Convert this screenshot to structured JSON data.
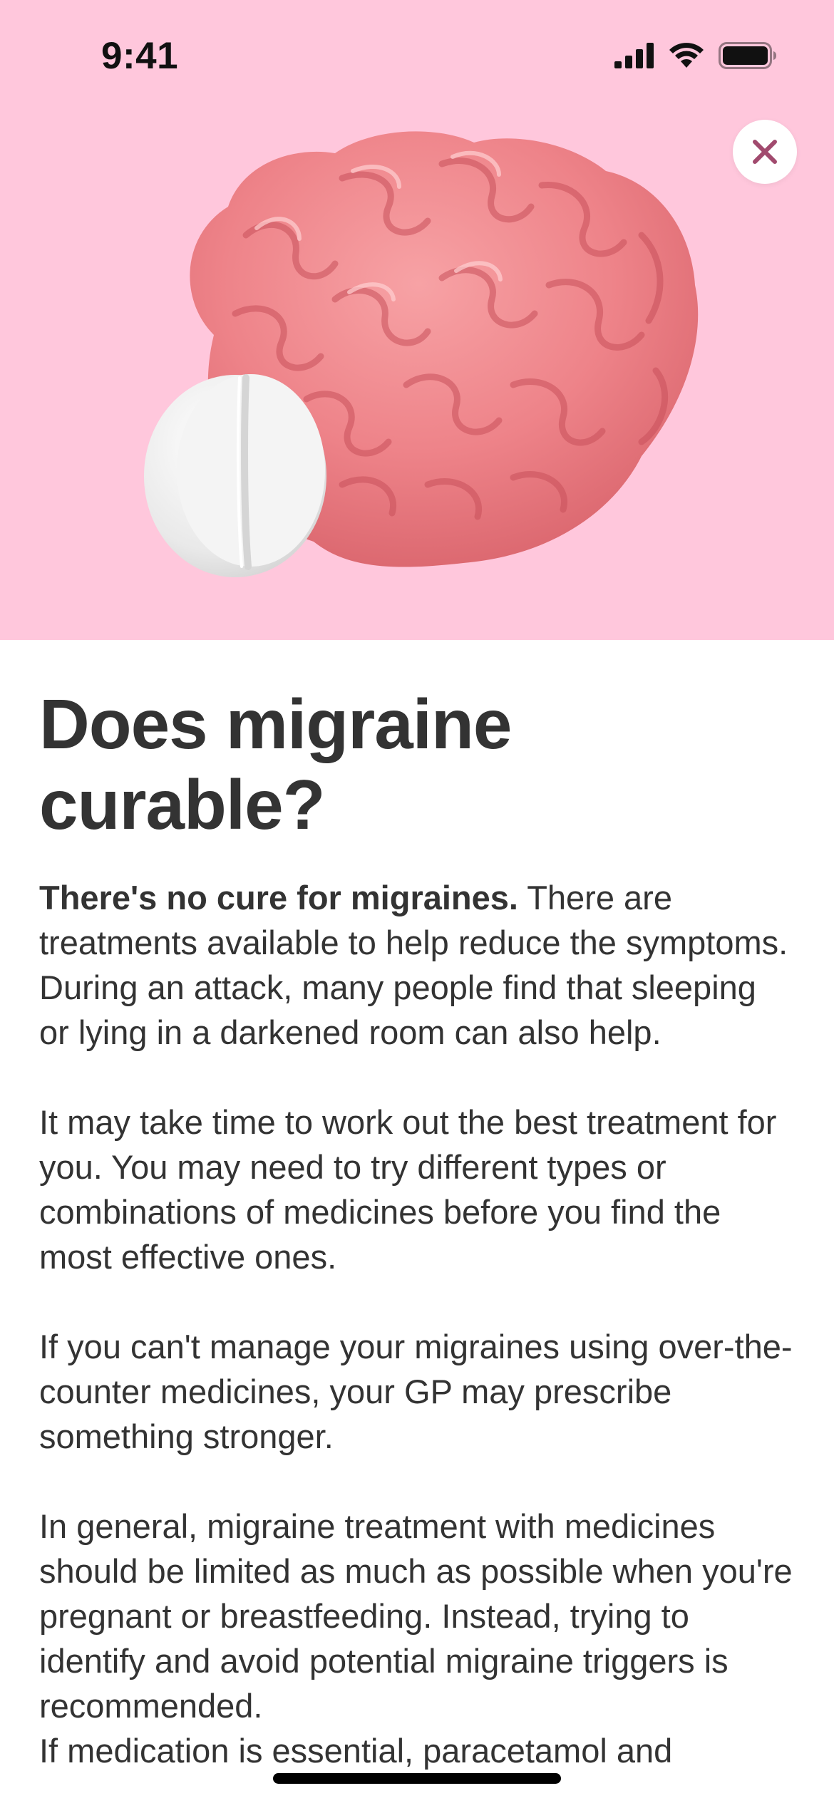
{
  "status_bar": {
    "time": "9:41"
  },
  "hero": {
    "background_color": "#ffc7dc",
    "illustration": "brain-and-pill"
  },
  "close_button": {
    "icon": "close-icon",
    "color": "#a14a6e"
  },
  "article": {
    "title": "Does migraine curable?",
    "paragraph_1_bold": "There's no cure for migraines.",
    "paragraph_1_rest": " There are treatments available to help reduce the symptoms. During an attack, many people find that sleeping or lying in a darkened room can also help.",
    "paragraph_2": "It may take time to work out the best treatment for you. You may need to try different types or combinations of medicines before you find the most effective ones.",
    "paragraph_3": "If you can't manage your migraines using over-the-counter medicines, your GP may prescribe something stronger.",
    "paragraph_4": "In general, migraine treatment with medicines should be limited as much as possible when you're pregnant or breastfeeding. Instead, trying to identify and avoid potential migraine triggers is recommended.",
    "paragraph_5": "If medication is essential, paracetamol and"
  }
}
